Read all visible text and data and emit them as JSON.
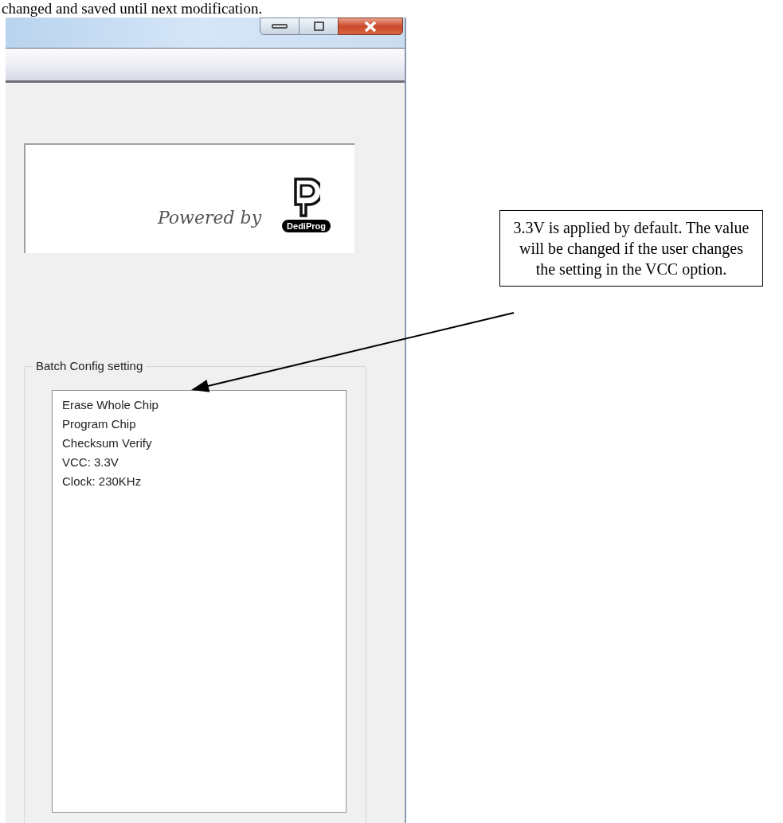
{
  "document_text": "changed and saved until next modification.",
  "window": {
    "logo": {
      "tagline": "Powered by",
      "brand": "DediProg"
    },
    "batch_config": {
      "title": "Batch Config setting",
      "items": [
        "Erase Whole Chip",
        "Program Chip",
        "Checksum Verify",
        "VCC: 3.3V",
        "Clock: 230KHz"
      ]
    }
  },
  "callout": {
    "text": "3.3V is applied by default. The value will be changed if the user changes the setting in the VCC option."
  }
}
